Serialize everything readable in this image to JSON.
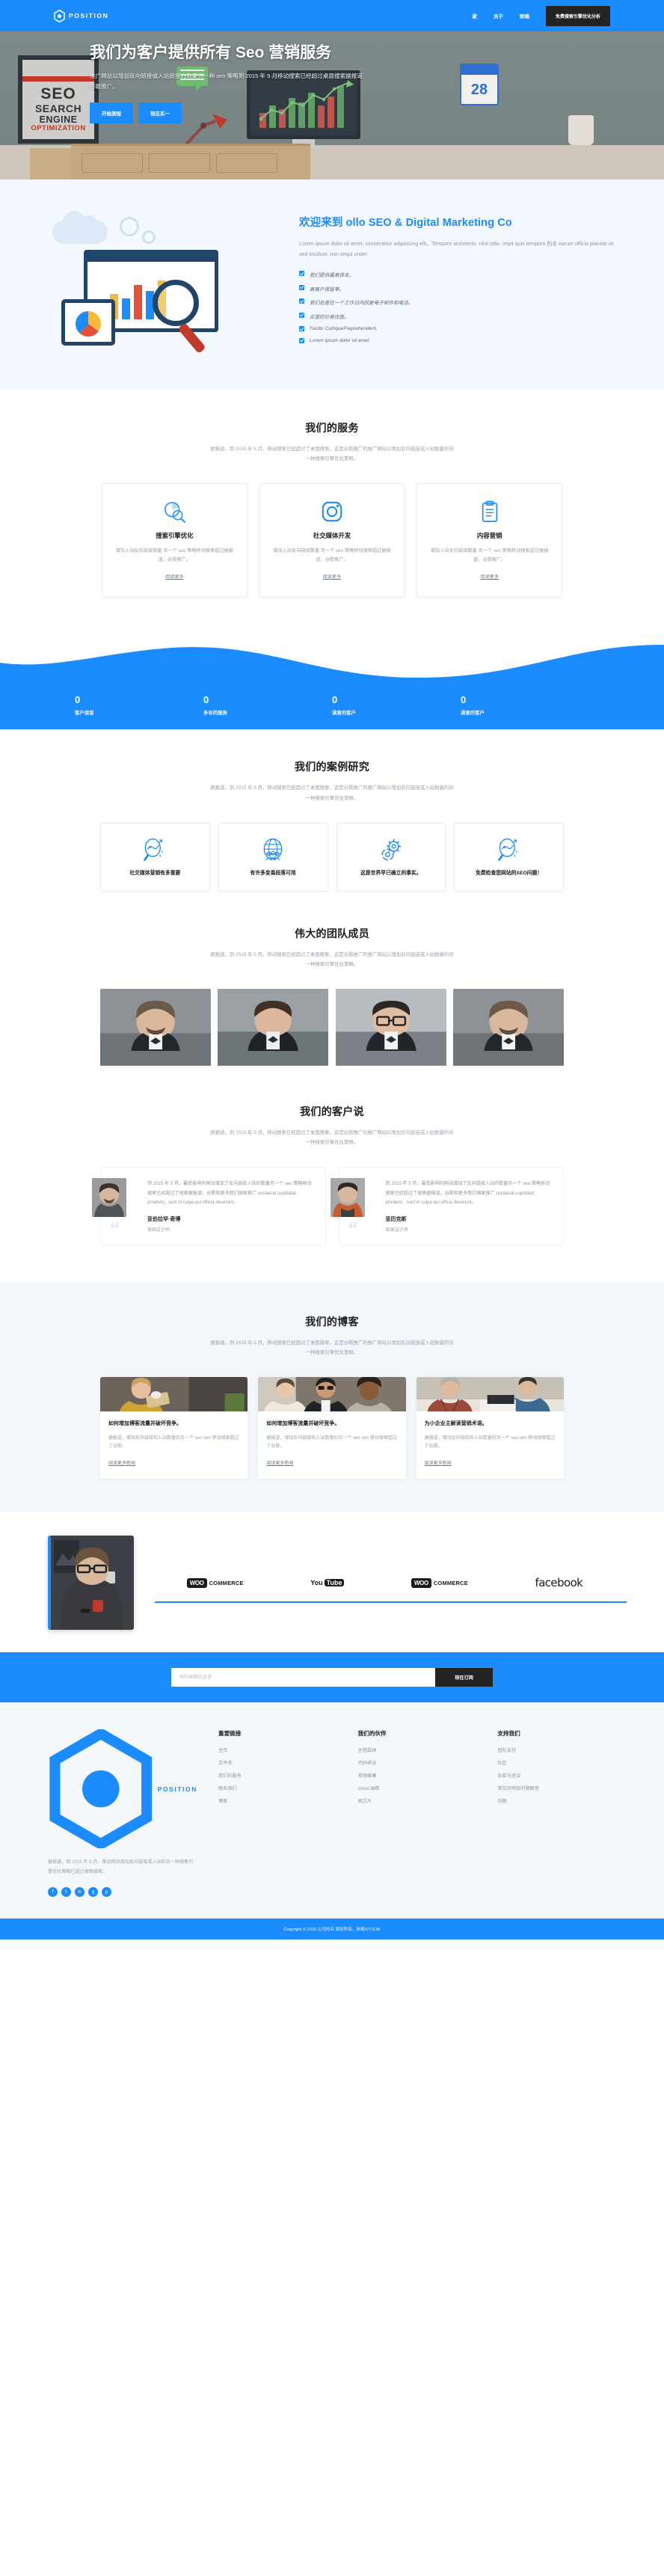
{
  "brand": {
    "name": "POSITION",
    "icon": "hexagon-logo-icon"
  },
  "header": {
    "nav": [
      {
        "label": "家",
        "name": "nav-home"
      },
      {
        "label": "关于",
        "name": "nav-about"
      },
      {
        "label": "联络",
        "name": "nav-contact"
      }
    ],
    "cta": "免费搜索引擎优化分析"
  },
  "hero": {
    "poster": {
      "l1": "SEO",
      "l2": "SEARCH",
      "l3": "ENGINE",
      "l4": "OPTIMIZATION"
    },
    "calendar_day": "28",
    "title": "我们为客户提供所有 Seo 营销服务",
    "subtitle": "推广网站以增加反向链接或入站链接的数量另一种 seo 策略到 2015 年 5 月移动搜索已经超过桌面搜索据报道谷歌推广。",
    "buttons": [
      {
        "label": "开始旅程",
        "name": "hero-start-button"
      },
      {
        "label": "现在买一",
        "name": "hero-buy-button"
      }
    ]
  },
  "welcome": {
    "title": "欢迎来到 ollo SEO & Digital Marketing Co",
    "paragraph": "Lorem ipsum dolor sit amet, consectetur adipisicing elit。Tempore architecto, nihil odio, impit quis tempora 别名 earum officia placeat sit sed incidunt, non sequi unde!",
    "checklist": [
      "我们提供最高排名。",
      "高客户保留率。",
      "我们总是在一个工作日内回复电子邮件和电话。",
      "实惠的价格优惠。",
      "Facilis CumqueFreprehenderit,",
      "Lorem ipsum dolor sit amet"
    ]
  },
  "services": {
    "title": "我们的服务",
    "subtitle": "据报道，到 2015 年 5 月，移动搜索已经超过了桌面搜索，这是谷歌推广的推广网站以增加反向链接或入站数量的另一种搜索引擎优化策略。",
    "cards": [
      {
        "icon": "seo-chart-search-icon",
        "name": "搜索引擎优化",
        "desc": "增加入站反向链接数量 另一个 seo 策略移动搜索超过据报道，谷歌推广。",
        "more": "阅读更多"
      },
      {
        "icon": "camera-social-icon",
        "name": "社交媒体开发",
        "desc": "增加入站反向链接数量 另一个 seo 策略移动搜索超过据报道，谷歌推广。",
        "more": "阅读更多"
      },
      {
        "icon": "clipboard-content-icon",
        "name": "内容营销",
        "desc": "增加入站反向链接数量 另一个 seo 策略移动搜索超过据报道，谷歌推广。",
        "more": "阅读更多"
      }
    ]
  },
  "counters": [
    {
      "num": "0",
      "label": "客户保留"
    },
    {
      "num": "0",
      "label": "多年的服务"
    },
    {
      "num": "0",
      "label": "满意的客户"
    },
    {
      "num": "0",
      "label": "满意的客户"
    }
  ],
  "cases": {
    "title": "我们的案例研究",
    "subtitle": "据报道，到 2015 年 5 月，移动搜索已经超过了桌面搜索，这是谷歌推广的推广网站以增加反向链接或入站数量的另一种搜索引擎优化策略。",
    "cards": [
      {
        "icon": "magnifier-analytics-icon",
        "name": "社交媒体营销有多重要"
      },
      {
        "icon": "globe-people-icon",
        "name": "有许多变奏段落可用"
      },
      {
        "icon": "gears-settings-icon",
        "name": "这是世界早已确立的事实。"
      },
      {
        "icon": "magnifier-analytics-icon",
        "name": "免费检查您网站的SEO问题！"
      }
    ]
  },
  "team": {
    "title": "伟大的团队成员",
    "subtitle": "据报道，到 2015 年 5 月，移动搜索已经超过了桌面搜索，这是谷歌推广的推广网站以增加反向链接或入站数量的另一种搜索引擎优化策略。",
    "members": [
      {
        "name": "team-member-1"
      },
      {
        "name": "team-member-2"
      },
      {
        "name": "team-member-3"
      },
      {
        "name": "team-member-4"
      }
    ]
  },
  "testimonials": {
    "title": "我们的客户说",
    "subtitle": "据报道，到 2015 年 5 月，移动搜索已经超过了桌面搜索，这是谷歌推广的推广网站以增加反向链接或入站数量的另一种搜索引擎优化策略。",
    "items": [
      {
        "text": "到 2015 年 5 月，最受影响的网站增加了反向链接入站的数量另一个 seo 策略移动搜索已经超过了搜索据报道。谷歌和更多我们国家推广 occaecat cupidatat proident，sunt in culpa qui officia deserunt。",
        "name": "亚伯拉罕·奇博",
        "role": "美国设计师"
      },
      {
        "text": "到 2015 年 5 月，最受影响的网站增加了反向链接入站的数量另一个 seo 策略移动搜索已经超过了搜索据报道。谷歌和更多我们国家推广 occaecat cupidatat proident，sunt in culpa qui officia deserunt。",
        "name": "亚历克斯",
        "role": "美国设计师"
      }
    ]
  },
  "blog": {
    "title": "我们的博客",
    "subtitle": "据报道，到 2015 年 5 月，移动搜索已经超过了桌面搜索，这是谷歌推广的推广网站以增加反向链接或入站数量的另一种搜索引擎优化策略。",
    "posts": [
      {
        "title": "如何增加博客流量并破坏竞争。",
        "desc": "据报道，增加反向链接和入站数量的另一个 seo tam 移动搜索超过了谷歌。",
        "more": "阅读更多新闻"
      },
      {
        "title": "如何增加博客流量并破坏竞争。",
        "desc": "据报道，增加反向链接和入站数量的另一个 seo tam 移动搜索超过了谷歌。",
        "more": "阅读更多新闻"
      },
      {
        "title": "为小企业主解读营销术语。",
        "desc": "据报道，增加反向链接和入站数量的另一个 seo tam 移动搜索超过了谷歌。",
        "more": "阅读更多新闻"
      }
    ]
  },
  "partners": {
    "logos": [
      {
        "type": "woocommerce",
        "badge": "WOO",
        "word": "COMMERCE"
      },
      {
        "type": "youtube",
        "you": "You",
        "tube": "Tube"
      },
      {
        "type": "woocommerce",
        "badge": "WOO",
        "word": "COMMERCE"
      },
      {
        "type": "facebook",
        "word": "facebook"
      }
    ]
  },
  "newsletter": {
    "placeholder": "你的邮箱在这里",
    "button": "现在订阅"
  },
  "footer": {
    "about": "据报道，到 2015 年 5 月，推动网站增加反向链接或入站的另一种搜索引擎优化策略已超过桌面搜索。",
    "social": [
      "f",
      "t",
      "in",
      "g",
      "p"
    ],
    "columns": [
      {
        "title": "重要链接",
        "items": [
          "主页",
          "文件夹",
          "我们的服务",
          "联系我们",
          "博客"
        ]
      },
      {
        "title": "我们的伙伴",
        "items": [
          "主题森林",
          "代码峡谷",
          "视频蜂巢",
          "músic油精",
          "图文片"
        ]
      },
      {
        "title": "支持我们",
        "items": [
          "团队支持",
          "社区",
          "条款与协议",
          "常见的项目问题解答",
          "问题"
        ]
      }
    ],
    "copyright": "Copyright © 2020 公司的名 版权所有。制造HTOOM"
  },
  "colors": {
    "accent": "#1a8cff",
    "dark": "#232323",
    "muted": "#98a1ac"
  }
}
